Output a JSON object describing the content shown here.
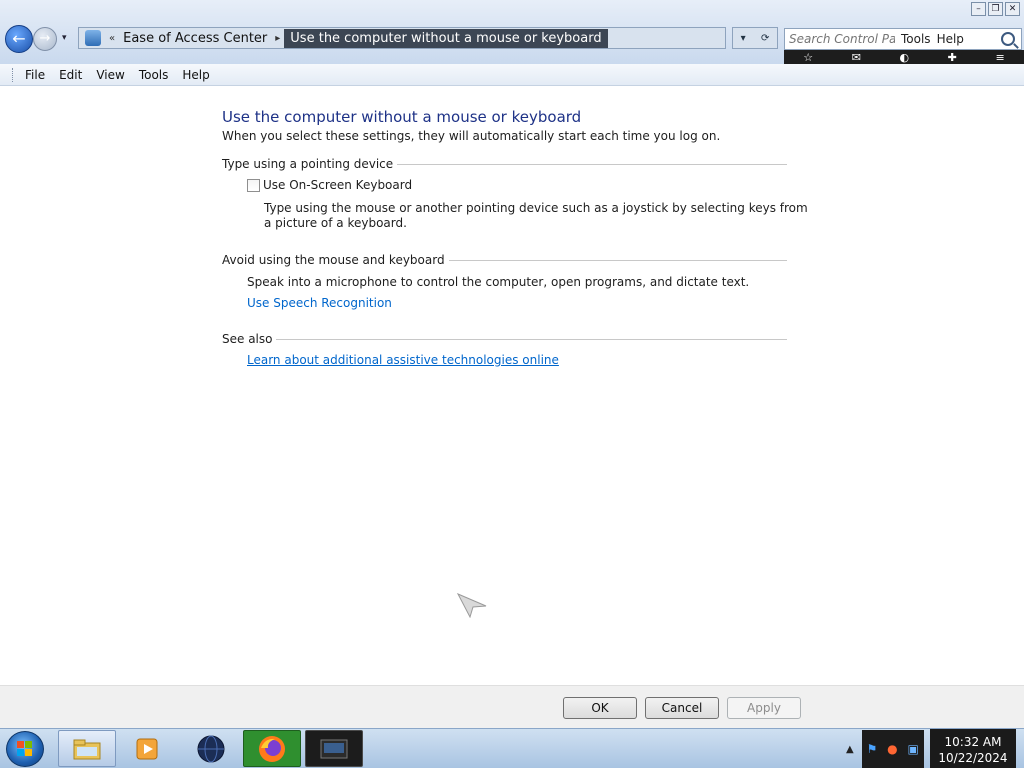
{
  "window": {
    "controls": [
      "minimize",
      "restore",
      "close"
    ]
  },
  "address": {
    "icon": "control-panel-icon",
    "separator": "«",
    "crumb1": "Ease of Access Center",
    "crumb2": "Use the computer without a mouse or keyboard"
  },
  "search": {
    "placeholder": "Search Control Panel",
    "ghost_tools": "Tools",
    "ghost_help": "Help"
  },
  "menu": [
    "File",
    "Edit",
    "View",
    "Tools",
    "Help"
  ],
  "content": {
    "title": "Use the computer without a mouse or keyboard",
    "description": "When you select these settings, they will automatically start each time you log on.",
    "section1": {
      "heading": "Type using a pointing device",
      "checkbox_label": "Use On-Screen Keyboard",
      "checkbox_checked": false,
      "help": "Type using the mouse or another pointing device such as a joystick by selecting keys from a picture of a keyboard."
    },
    "section2": {
      "heading": "Avoid using the mouse and keyboard",
      "text": "Speak into a microphone to control the computer, open programs, and dictate text.",
      "link": "Use Speech Recognition"
    },
    "section3": {
      "heading": "See also",
      "link": "Learn about additional assistive technologies online"
    }
  },
  "buttons": {
    "ok": "OK",
    "cancel": "Cancel",
    "apply": "Apply"
  },
  "taskbar": {
    "items": [
      "explorer-icon",
      "media-player-icon",
      "globe-icon",
      "firefox-icon",
      "terminal-icon"
    ],
    "time": "10:32 AM",
    "date": "10/22/2024"
  }
}
